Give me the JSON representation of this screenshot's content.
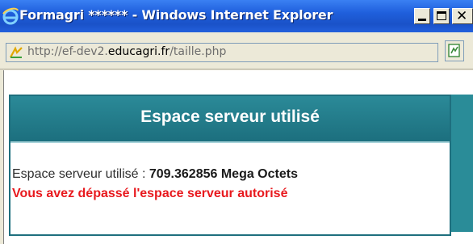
{
  "window": {
    "title": "Formagri ****** - Windows Internet Explorer",
    "min_icon": "minimize-icon",
    "max_icon": "maximize-icon",
    "close_glyph": "✕",
    "close_icon": "close-icon",
    "browser_icon": "internet-explorer-icon"
  },
  "address_bar": {
    "url_prefix": "http://ef-dev2.",
    "url_domain": "educagri.fr",
    "url_suffix": "/taille.php",
    "page_icon": "page-favicon-icon",
    "compat_icon": "compatibility-view-icon"
  },
  "panel": {
    "title": "Espace serveur utilisé",
    "usage_label": "Espace serveur utilisé : ",
    "usage_value": "709.362856 Mega Octets",
    "warning": "Vous avez dépassé l'espace serveur autorisé"
  },
  "colors": {
    "titlebar": "#1f5fdc",
    "panel_header": "#1c6f7e",
    "warning_text": "#e8191e"
  }
}
